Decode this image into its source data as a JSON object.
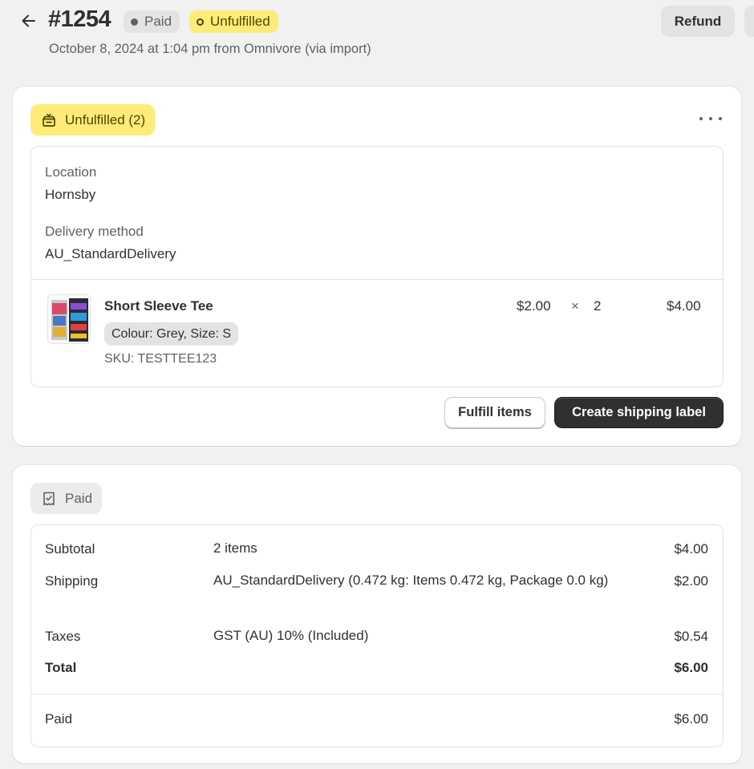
{
  "header": {
    "order_number": "#1254",
    "payment_badge": "Paid",
    "fulfillment_badge": "Unfulfilled",
    "subtitle": "October 8, 2024 at 1:04 pm from Omnivore (via import)",
    "refund_label": "Refund"
  },
  "fulfillment_card": {
    "status_label": "Unfulfilled (2)",
    "location_label": "Location",
    "location_value": "Hornsby",
    "delivery_label": "Delivery method",
    "delivery_value": "AU_StandardDelivery",
    "item": {
      "name": "Short Sleeve Tee",
      "variant": "Colour: Grey, Size: S",
      "sku": "SKU: TESTTEE123",
      "unit_price": "$2.00",
      "times": "×",
      "quantity": "2",
      "total": "$4.00"
    },
    "fulfill_button": "Fulfill items",
    "shipping_label_button": "Create shipping label"
  },
  "payment_card": {
    "status_label": "Paid",
    "rows": [
      {
        "label": "Subtotal",
        "desc": "2 items",
        "amount": "$4.00"
      },
      {
        "label": "Shipping",
        "desc": "AU_StandardDelivery (0.472 kg: Items 0.472 kg, Package 0.0 kg)",
        "amount": "$2.00"
      },
      {
        "label": "Taxes",
        "desc": "GST (AU) 10% (Included)",
        "amount": "$0.54"
      },
      {
        "label": "Total",
        "desc": "",
        "amount": "$6.00"
      }
    ],
    "paid_label": "Paid",
    "paid_amount": "$6.00"
  },
  "colors": {
    "accent_unfulfilled": "#ffeb78",
    "primary_button": "#303030",
    "page_bg": "#f1f1f1"
  },
  "icons": [
    "arrow-left-icon",
    "status-dot-icon",
    "status-ring-icon",
    "fulfillment-box-icon",
    "more-horizontal-icon",
    "receipt-check-icon"
  ]
}
